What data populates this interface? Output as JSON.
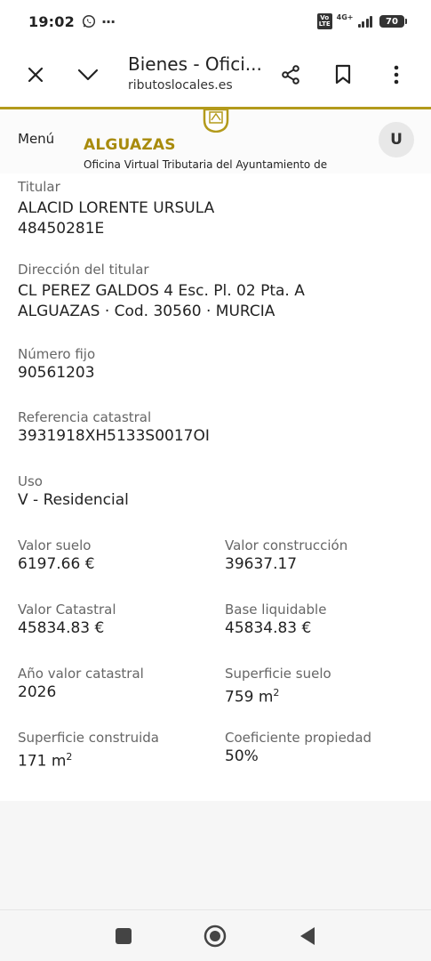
{
  "status": {
    "time": "19:02",
    "whatsapp_icon": "whatsapp-icon",
    "more": "···",
    "volte": "Vo LTE",
    "network": "4G+",
    "battery": "70"
  },
  "browser": {
    "tab_title": "Bienes - Ofici...",
    "url": "ributoslocales.es",
    "icons": [
      "close-icon",
      "chevron-down-icon",
      "share-icon",
      "bookmark-icon",
      "more-vert-icon"
    ]
  },
  "site": {
    "menu": "Menú",
    "brand_name": "ALGUAZAS",
    "brand_subtitle": "Oficina Virtual Tributaria del Ayuntamiento de Alguazas",
    "user_initial": "U",
    "accent": "#a88b0c",
    "line_color": "#b39a1b"
  },
  "property": {
    "titular": {
      "label": "Titular",
      "name": "ALACID LORENTE URSULA",
      "id": "48450281E"
    },
    "direccion": {
      "label": "Dirección del titular",
      "line1": "CL PEREZ GALDOS 4 Esc. Pl. 02 Pta. A",
      "line2": "ALGUAZAS · Cod. 30560 · MURCIA"
    },
    "numero_fijo": {
      "label": "Número fijo",
      "value": "90561203"
    },
    "referencia": {
      "label": "Referencia catastral",
      "value": "3931918XH5133S0017OI"
    },
    "uso": {
      "label": "Uso",
      "value": "V - Residencial"
    },
    "valor_suelo": {
      "label": "Valor suelo",
      "value": "6197.66 €"
    },
    "valor_construccion": {
      "label": "Valor construcción",
      "value": "39637.17"
    },
    "valor_catastral": {
      "label": "Valor Catastral",
      "value": "45834.83 €"
    },
    "base_liquidable": {
      "label": "Base liquidable",
      "value": "45834.83 €"
    },
    "anio_valor": {
      "label": "Año valor catastral",
      "value": "2026"
    },
    "superficie_suelo": {
      "label": "Superficie suelo",
      "value": "759 m",
      "unit_exp": "2"
    },
    "superficie_construida": {
      "label": "Superficie construida",
      "value": "171 m",
      "unit_exp": "2"
    },
    "coeficiente": {
      "label": "Coeficiente propiedad",
      "value": "50%"
    }
  },
  "navbar": {
    "icons": [
      "recents-square-icon",
      "home-circle-icon",
      "back-triangle-icon"
    ]
  }
}
